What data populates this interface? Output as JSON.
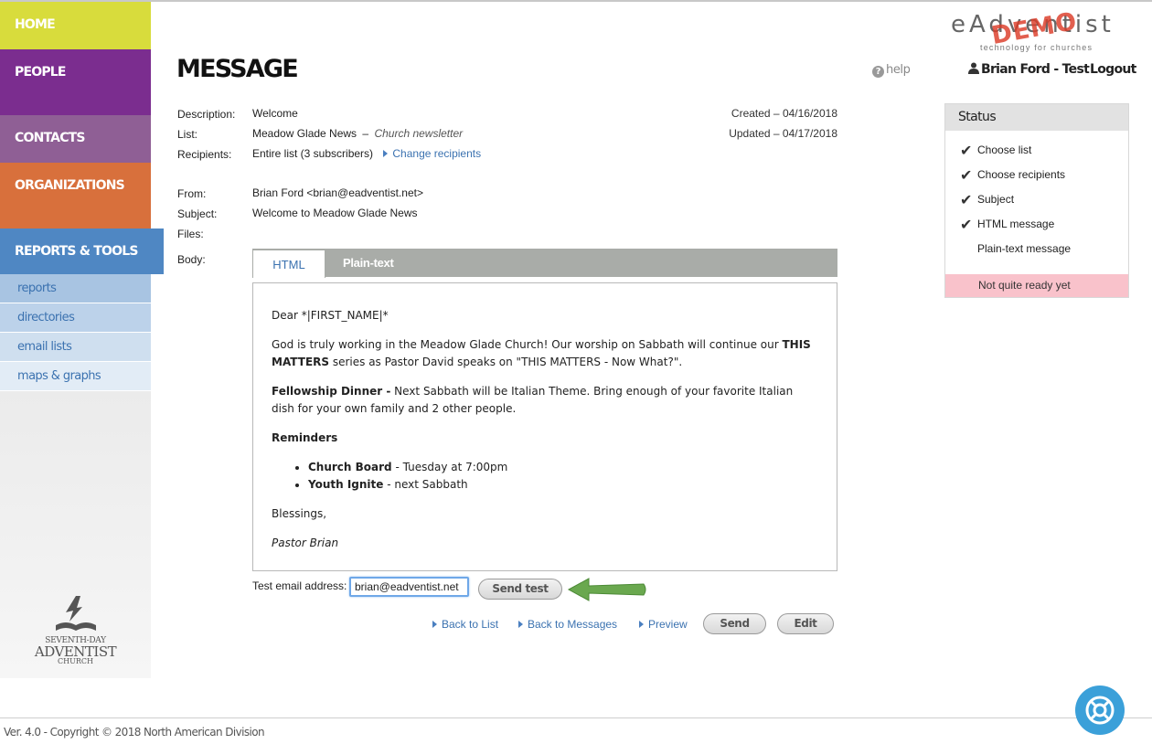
{
  "brand": {
    "name": "eAdventist",
    "demo_stamp": "DEMO",
    "tagline": "technology for churches"
  },
  "nav": {
    "home": "HOME",
    "people": "PEOPLE",
    "contacts": "CONTACTS",
    "organizations": "ORGANIZATIONS",
    "reports_tools": "REPORTS & TOOLS",
    "sub": [
      "reports",
      "directories",
      "email lists",
      "maps & graphs"
    ]
  },
  "sda_logo": {
    "line1": "SEVENTH-DAY",
    "line2": "ADVENTIST",
    "line3": "CHURCH"
  },
  "header": {
    "title": "MESSAGE",
    "help": "help",
    "user": "Brian Ford - Test",
    "logout": "Logout"
  },
  "details": {
    "description_label": "Description:",
    "description": "Welcome",
    "list_label": "List:",
    "list_name": "Meadow Glade News",
    "list_sep": "–",
    "list_desc": "Church newsletter",
    "recipients_label": "Recipients:",
    "recipients": "Entire list (3 subscribers)",
    "change_recipients": "Change recipients",
    "created": "Created – 04/16/2018",
    "updated": "Updated – 04/17/2018",
    "from_label": "From:",
    "from": "Brian Ford <brian@eadventist.net>",
    "subject_label": "Subject:",
    "subject": "Welcome to Meadow Glade News",
    "files_label": "Files:",
    "body_label": "Body:"
  },
  "tabs": {
    "html": "HTML",
    "plain": "Plain-text"
  },
  "message": {
    "greeting": "Dear *|FIRST_NAME|*",
    "p1_a": "God is truly working in the Meadow Glade Church! Our worship on Sabbath will continue our ",
    "p1_b": "THIS MATTERS",
    "p1_c": " series as Pastor David speaks on \"THIS MATTERS - Now What?\".",
    "p2_b": "Fellowship Dinner -",
    "p2_c": " Next Sabbath will be Italian Theme. Bring enough of your favorite Italian dish for your own family and 2 other people.",
    "reminders": "Reminders",
    "r1_b": "Church Board",
    "r1_c": " - Tuesday at 7:00pm",
    "r2_b": "Youth Ignite",
    "r2_c": " - next Sabbath",
    "closing": "Blessings,",
    "signature": "Pastor Brian"
  },
  "test": {
    "label": "Test email address:",
    "value": "brian@eadventist.net",
    "button": "Send test"
  },
  "actions": {
    "back_list": "Back to List",
    "back_messages": "Back to Messages",
    "preview": "Preview",
    "send": "Send",
    "edit": "Edit"
  },
  "status": {
    "title": "Status",
    "items": [
      {
        "label": "Choose list",
        "done": true
      },
      {
        "label": "Choose recipients",
        "done": true
      },
      {
        "label": "Subject",
        "done": true
      },
      {
        "label": "HTML message",
        "done": true
      },
      {
        "label": "Plain-text message",
        "done": false
      }
    ],
    "warning": "Not quite ready yet"
  },
  "footer": {
    "text": "Ver. 4.0 - Copyright © 2018 North American Division"
  },
  "colors": {
    "home": "#d8dc3c",
    "people": "#7b2d8f",
    "contacts": "#8f5f95",
    "organizations": "#d8703c",
    "reports": "#4f87c3",
    "link": "#3b72b0",
    "warning_bg": "#f9c2cb",
    "arrow": "#6aa84f"
  }
}
